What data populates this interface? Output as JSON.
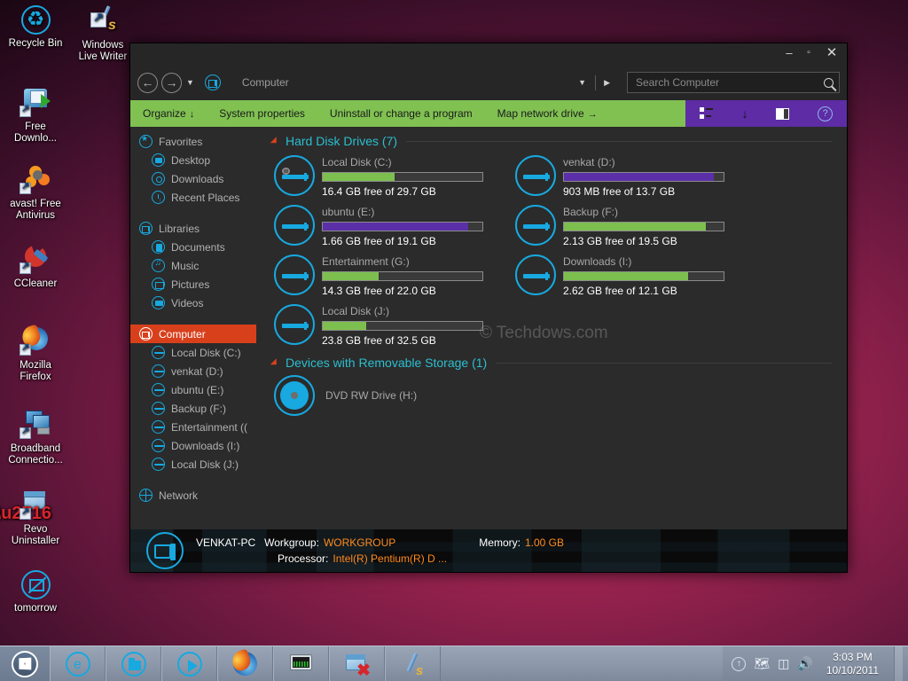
{
  "desktop": {
    "icons": [
      {
        "label": "Recycle Bin",
        "icon": "recycle-bin-icon"
      },
      {
        "label": "Windows\nLive Writer",
        "line1": "Windows",
        "line2": "Live Writer",
        "icon": "windows-live-writer-icon"
      },
      {
        "label": "Free Downlo...",
        "line1": "Free",
        "line2": "Downlo...",
        "icon": "free-download-manager-icon"
      },
      {
        "label": "avast! Free Antivirus",
        "line1": "avast! Free",
        "line2": "Antivirus",
        "icon": "avast-antivirus-icon"
      },
      {
        "label": "CCleaner",
        "line1": "CCleaner",
        "line2": "",
        "icon": "ccleaner-icon"
      },
      {
        "label": "Mozilla Firefox",
        "line1": "Mozilla",
        "line2": "Firefox",
        "icon": "mozilla-firefox-icon"
      },
      {
        "label": "Broadband Connectio...",
        "line1": "Broadband",
        "line2": "Connectio...",
        "icon": "broadband-connection-icon"
      },
      {
        "label": "Revo Uninstaller",
        "line1": "Revo",
        "line2": "Uninstaller",
        "icon": "revo-uninstaller-icon"
      },
      {
        "label": "tomorrow",
        "line1": "tomorrow",
        "line2": "",
        "icon": "tomorrow-note-icon"
      }
    ]
  },
  "window": {
    "title_buttons": {
      "minimize": "–",
      "maximize": "▫",
      "close": "✕"
    },
    "nav": {
      "back": "←",
      "forward": "→",
      "history_caret": "▼",
      "address_value": "Computer",
      "address_dropdown": "▼",
      "address_go": "▶"
    },
    "search": {
      "placeholder": "Search Computer",
      "value": ""
    },
    "commandbar": {
      "items": [
        {
          "label": "Organize",
          "caret": "↓"
        },
        {
          "label": "System properties",
          "caret": ""
        },
        {
          "label": "Uninstall or change a program",
          "caret": ""
        },
        {
          "label": "Map network drive",
          "caret": "→"
        }
      ],
      "right_icons": [
        {
          "name": "change-view-icon"
        },
        {
          "name": "view-dropdown-arrow-icon",
          "glyph": "↓"
        },
        {
          "name": "show-preview-pane-icon"
        },
        {
          "name": "help-icon",
          "glyph": "?"
        }
      ]
    },
    "sidebar": {
      "sections": [
        {
          "header": {
            "label": "Favorites",
            "icon": "favorites-star-icon"
          },
          "items": [
            {
              "label": "Desktop",
              "icon": "desktop-icon"
            },
            {
              "label": "Downloads",
              "icon": "downloads-icon"
            },
            {
              "label": "Recent Places",
              "icon": "recent-places-clock-icon"
            }
          ]
        },
        {
          "header": {
            "label": "Libraries",
            "icon": "libraries-icon"
          },
          "items": [
            {
              "label": "Documents",
              "icon": "documents-icon"
            },
            {
              "label": "Music",
              "icon": "music-icon"
            },
            {
              "label": "Pictures",
              "icon": "pictures-icon"
            },
            {
              "label": "Videos",
              "icon": "videos-icon"
            }
          ]
        },
        {
          "header": {
            "label": "Computer",
            "icon": "computer-icon",
            "selected": true
          },
          "items": [
            {
              "label": "Local Disk (C:)",
              "icon": "drive-icon"
            },
            {
              "label": "venkat (D:)",
              "icon": "drive-icon"
            },
            {
              "label": "ubuntu (E:)",
              "icon": "drive-icon"
            },
            {
              "label": "Backup (F:)",
              "icon": "drive-icon"
            },
            {
              "label": "Entertainment ((",
              "icon": "drive-icon"
            },
            {
              "label": "Downloads (I:)",
              "icon": "drive-icon"
            },
            {
              "label": "Local Disk (J:)",
              "icon": "drive-icon"
            }
          ]
        },
        {
          "header": {
            "label": "Network",
            "icon": "network-globe-icon"
          },
          "items": []
        }
      ]
    },
    "content": {
      "group_hard_disks": "Hard Disk Drives (7)",
      "group_removable": "Devices with Removable Storage (1)",
      "watermark": "© Techdows.com",
      "drives": [
        {
          "name": "Local Disk (C:)",
          "free_text": "16.4 GB free of 29.7 GB",
          "used_percent": 45,
          "fill_color": "#7dbf4e",
          "system": true
        },
        {
          "name": "venkat (D:)",
          "free_text": "903 MB free of 13.7 GB",
          "used_percent": 94,
          "fill_color": "#5b2fa8",
          "system": false
        },
        {
          "name": "ubuntu (E:)",
          "free_text": "1.66 GB free of 19.1 GB",
          "used_percent": 91,
          "fill_color": "#5b2fa8",
          "system": false
        },
        {
          "name": "Backup (F:)",
          "free_text": "2.13 GB free of 19.5 GB",
          "used_percent": 89,
          "fill_color": "#7dbf4e",
          "system": false
        },
        {
          "name": "Entertainment (G:)",
          "free_text": "14.3 GB free of 22.0 GB",
          "used_percent": 35,
          "fill_color": "#7dbf4e",
          "system": false
        },
        {
          "name": "Downloads (I:)",
          "free_text": "2.62 GB free of 12.1 GB",
          "used_percent": 78,
          "fill_color": "#7dbf4e",
          "system": false
        },
        {
          "name": "Local Disk (J:)",
          "free_text": "23.8 GB free of 32.5 GB",
          "used_percent": 27,
          "fill_color": "#7dbf4e",
          "system": false
        }
      ],
      "removable": [
        {
          "name": "DVD RW Drive (H:)",
          "icon": "dvd-drive-icon"
        }
      ]
    },
    "statusbar": {
      "computer_name": "VENKAT-PC",
      "workgroup_label": "Workgroup:",
      "workgroup_value": "WORKGROUP",
      "memory_label": "Memory:",
      "memory_value": "1.00 GB",
      "processor_label": "Processor:",
      "processor_value": "Intel(R) Pentium(R) D ..."
    }
  },
  "taskbar": {
    "start_button": "start-orb-icon",
    "buttons": [
      {
        "name": "internet-explorer-icon",
        "glyph": "e"
      },
      {
        "name": "windows-explorer-icon",
        "glyph": ""
      },
      {
        "name": "windows-media-player-icon",
        "glyph": ""
      },
      {
        "name": "mozilla-firefox-icon",
        "glyph": ""
      },
      {
        "name": "system-monitor-icon",
        "glyph": ""
      },
      {
        "name": "revo-uninstaller-icon",
        "glyph": ""
      },
      {
        "name": "windows-live-writer-icon",
        "glyph": ""
      }
    ],
    "tray": [
      {
        "name": "show-hidden-icons-icon",
        "glyph": "↑"
      },
      {
        "name": "safely-remove-hardware-icon",
        "glyph": "🖌"
      },
      {
        "name": "network-icon",
        "glyph": "❐"
      },
      {
        "name": "volume-icon",
        "glyph": "🔊"
      }
    ],
    "clock": {
      "time": "3:03 PM",
      "date": "10/10/2011"
    }
  },
  "colors": {
    "accent_cyan": "#17a9e0",
    "command_green": "#80c152",
    "command_purple": "#5e2ca5",
    "selection_red": "#d8401c",
    "group_header_cyan": "#2bbfcf",
    "status_orange": "#ff8a1e"
  }
}
